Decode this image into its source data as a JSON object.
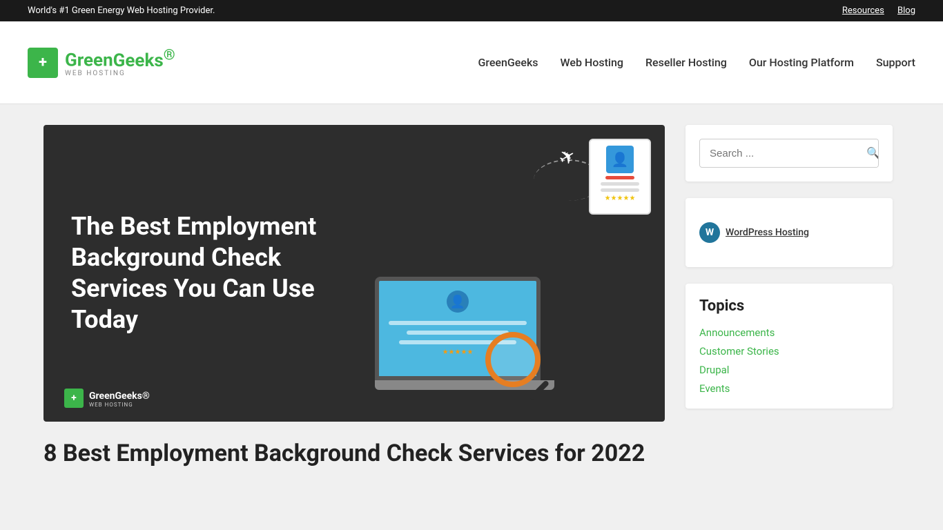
{
  "topbar": {
    "tagline": "World's #1 Green Energy Web Hosting Provider.",
    "links": [
      {
        "label": "Resources",
        "url": "#"
      },
      {
        "label": "Blog",
        "url": "#"
      }
    ]
  },
  "header": {
    "logo": {
      "icon": "+",
      "brand_prefix": "Green",
      "brand_suffix": "Geeks",
      "trademark": "®",
      "sub": "WEB HOSTING"
    },
    "nav": [
      {
        "label": "GreenGeeks",
        "url": "#"
      },
      {
        "label": "Web Hosting",
        "url": "#"
      },
      {
        "label": "Reseller Hosting",
        "url": "#"
      },
      {
        "label": "Our Hosting Platform",
        "url": "#"
      },
      {
        "label": "Support",
        "url": "#"
      }
    ]
  },
  "hero": {
    "title": "The Best Employment Background Check Services You Can Use Today",
    "logo_in_image": {
      "icon": "+",
      "brand": "GreenGeeks®",
      "sub": "WEB HOSTING"
    }
  },
  "article": {
    "title": "8 Best Employment Background Check Services for 2022"
  },
  "sidebar": {
    "search": {
      "placeholder": "Search ...",
      "button_label": "Search",
      "button_icon": "🔍"
    },
    "wp_ad": {
      "label": "WordPress Hosting"
    },
    "topics": {
      "heading": "Topics",
      "items": [
        {
          "label": "Announcements",
          "url": "#"
        },
        {
          "label": "Customer Stories",
          "url": "#"
        },
        {
          "label": "Drupal",
          "url": "#"
        },
        {
          "label": "Events",
          "url": "#"
        }
      ]
    }
  }
}
